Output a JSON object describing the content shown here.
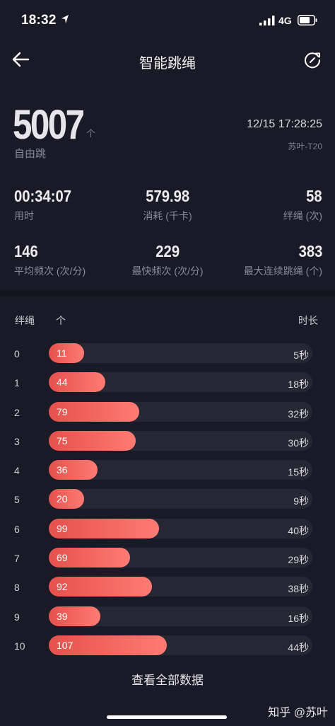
{
  "status_bar": {
    "time": "18:32",
    "network": "4G"
  },
  "nav": {
    "title": "智能跳绳"
  },
  "summary": {
    "count": "5007",
    "count_unit": "个",
    "mode": "自由跳",
    "datetime": "12/15 17:28:25",
    "device": "苏叶-T20"
  },
  "stats": [
    {
      "value": "00:34:07",
      "label": "用时"
    },
    {
      "value": "579.98",
      "label": "消耗 (千卡)"
    },
    {
      "value": "58",
      "label": "绊绳 (次)"
    },
    {
      "value": "146",
      "label": "平均频次 (次/分)"
    },
    {
      "value": "229",
      "label": "最快频次 (次/分)"
    },
    {
      "value": "383",
      "label": "最大连续跳绳 (个)"
    }
  ],
  "table": {
    "header_set": "绊绳",
    "header_count": "个",
    "header_duration": "时长",
    "rows": [
      {
        "index": "0",
        "count": 11,
        "duration": "5秒"
      },
      {
        "index": "1",
        "count": 44,
        "duration": "18秒"
      },
      {
        "index": "2",
        "count": 79,
        "duration": "32秒"
      },
      {
        "index": "3",
        "count": 75,
        "duration": "30秒"
      },
      {
        "index": "4",
        "count": 36,
        "duration": "15秒"
      },
      {
        "index": "5",
        "count": 20,
        "duration": "9秒"
      },
      {
        "index": "6",
        "count": 99,
        "duration": "40秒"
      },
      {
        "index": "7",
        "count": 69,
        "duration": "29秒"
      },
      {
        "index": "8",
        "count": 92,
        "duration": "38秒"
      },
      {
        "index": "9",
        "count": 39,
        "duration": "16秒"
      },
      {
        "index": "10",
        "count": 107,
        "duration": "44秒"
      }
    ]
  },
  "view_all_label": "查看全部数据",
  "watermark": "知乎 @苏叶",
  "colors": {
    "background": "#1a1a26",
    "bar_track": "#272733",
    "bar_fill_start": "#e5514c",
    "bar_fill_end": "#ff7b73"
  },
  "icons": {
    "back": "arrow-left-icon",
    "refresh": "refresh-icon",
    "location": "location-arrow-icon",
    "signal": "signal-bars-icon",
    "battery": "battery-icon"
  }
}
